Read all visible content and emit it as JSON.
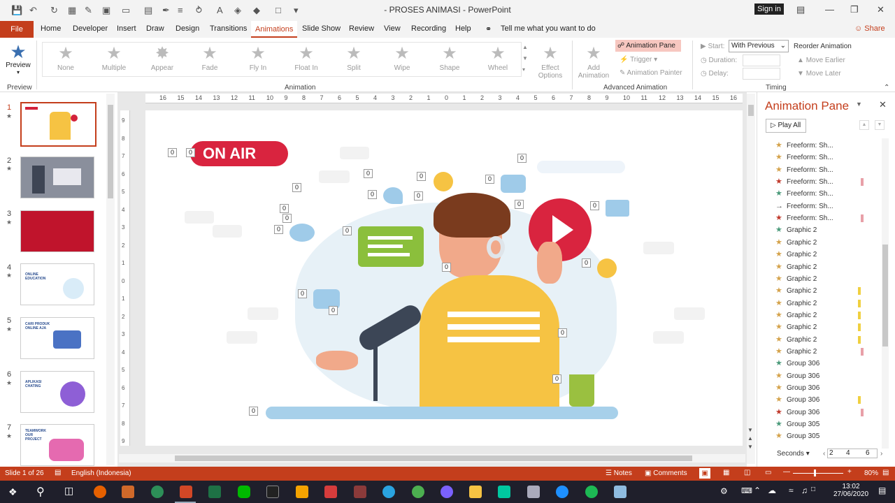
{
  "titlebar": {
    "title": "- PROSES ANIMASI  -  PowerPoint",
    "signin": "Sign in"
  },
  "tabs": {
    "file": "File",
    "items": [
      "Home",
      "Developer",
      "Insert",
      "Draw",
      "Design",
      "Transitions",
      "Animations",
      "Slide Show",
      "Review",
      "View",
      "Recording",
      "Help"
    ],
    "tellme": "Tell me what you want to do",
    "share": "Share"
  },
  "ribbon": {
    "preview": "Preview",
    "preview_group": "Preview",
    "effects": [
      "None",
      "Multiple",
      "Appear",
      "Fade",
      "Fly In",
      "Float In",
      "Split",
      "Wipe",
      "Shape",
      "Wheel"
    ],
    "effect_options": "Effect Options",
    "animation_group": "Animation",
    "add_animation": "Add Animation",
    "animation_pane": "Animation Pane",
    "trigger": "Trigger",
    "animation_painter": "Animation Painter",
    "advanced_group": "Advanced Animation",
    "start_label": "Start:",
    "start_value": "With Previous",
    "duration_label": "Duration:",
    "delay_label": "Delay:",
    "timing_group": "Timing",
    "reorder": "Reorder Animation",
    "move_earlier": "Move Earlier",
    "move_later": "Move Later"
  },
  "slides": [
    {
      "num": "1"
    },
    {
      "num": "2"
    },
    {
      "num": "3"
    },
    {
      "num": "4",
      "text": "ONLINE EDUCATION"
    },
    {
      "num": "5",
      "text": "CARI PRODUK ONLINE AJA"
    },
    {
      "num": "6",
      "text": "APLIKASI CHATING"
    },
    {
      "num": "7",
      "text": "TEAMWORK OUR PROJECT"
    }
  ],
  "ruler": {
    "top": [
      "16",
      "15",
      "14",
      "13",
      "12",
      "11",
      "10",
      "9",
      "8",
      "7",
      "6",
      "5",
      "4",
      "3",
      "2",
      "1",
      "0",
      "1",
      "2",
      "3",
      "4",
      "5",
      "6",
      "7",
      "8",
      "9",
      "10",
      "11",
      "12",
      "13",
      "14",
      "15",
      "16"
    ],
    "left": [
      "9",
      "8",
      "7",
      "6",
      "5",
      "4",
      "3",
      "2",
      "1",
      "0",
      "1",
      "2",
      "3",
      "4",
      "5",
      "6",
      "7",
      "8",
      "9"
    ]
  },
  "slide": {
    "on_air": "ON AIR",
    "zero": "0"
  },
  "animpane": {
    "title": "Animation Pane",
    "play_all": "Play All",
    "items": [
      {
        "label": "Freeform: Sh...",
        "color": "#d4a24a"
      },
      {
        "label": "Freeform: Sh...",
        "color": "#d4a24a"
      },
      {
        "label": "Freeform: Sh...",
        "color": "#d4a24a"
      },
      {
        "label": "Freeform: Sh...",
        "color": "#c0392b",
        "bar": "#e8a0a8"
      },
      {
        "label": "Freeform: Sh...",
        "color": "#4a9a7a"
      },
      {
        "label": "Freeform: Sh...",
        "color": "#555"
      },
      {
        "label": "Freeform: Sh...",
        "color": "#c0392b",
        "bar": "#e8a0a8"
      },
      {
        "label": "Graphic 2",
        "color": "#4a9a7a"
      },
      {
        "label": "Graphic 2",
        "color": "#d4a24a"
      },
      {
        "label": "Graphic 2",
        "color": "#d4a24a"
      },
      {
        "label": "Graphic 2",
        "color": "#d4a24a"
      },
      {
        "label": "Graphic 2",
        "color": "#d4a24a"
      },
      {
        "label": "Graphic 2",
        "color": "#d4a24a",
        "bar": "#f0d040"
      },
      {
        "label": "Graphic 2",
        "color": "#d4a24a",
        "bar": "#f0d040"
      },
      {
        "label": "Graphic 2",
        "color": "#d4a24a",
        "bar": "#f0d040"
      },
      {
        "label": "Graphic 2",
        "color": "#d4a24a",
        "bar": "#f0d040"
      },
      {
        "label": "Graphic 2",
        "color": "#d4a24a",
        "bar": "#f0d040"
      },
      {
        "label": "Graphic 2",
        "color": "#d4a24a",
        "bar": "#e8a0a8"
      },
      {
        "label": "Group 306",
        "color": "#4a9a7a"
      },
      {
        "label": "Group 306",
        "color": "#d4a24a"
      },
      {
        "label": "Group 306",
        "color": "#d4a24a"
      },
      {
        "label": "Group 306",
        "color": "#d4a24a",
        "bar": "#f0d040"
      },
      {
        "label": "Group 306",
        "color": "#c0392b",
        "bar": "#e8a0a8"
      },
      {
        "label": "Group 305",
        "color": "#4a9a7a"
      },
      {
        "label": "Group 305",
        "color": "#d4a24a"
      }
    ],
    "seconds": "Seconds",
    "sec_values": [
      "2",
      "4",
      "6"
    ]
  },
  "status": {
    "slide": "Slide 1 of 26",
    "language": "English (Indonesia)",
    "notes": "Notes",
    "comments": "Comments",
    "zoom": "80%"
  },
  "taskbar": {
    "time": "13:02",
    "date": "27/06/2020"
  }
}
